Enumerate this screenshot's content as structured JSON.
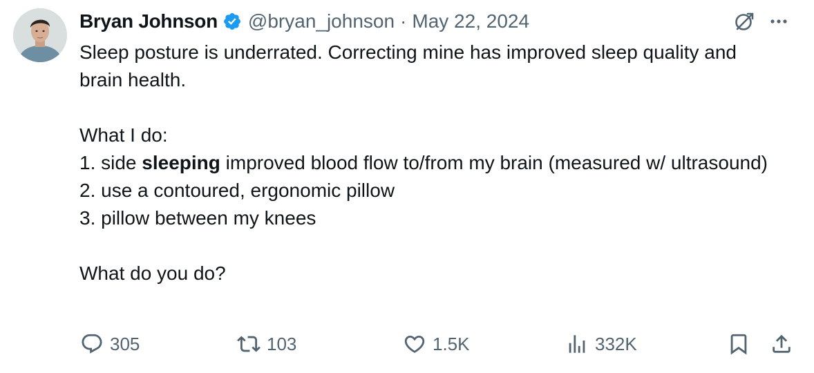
{
  "author": {
    "display_name": "Bryan Johnson",
    "handle": "@bryan_johnson",
    "separator": "·",
    "date": "May 22, 2024",
    "verified": true
  },
  "post": {
    "line1": "Sleep posture is underrated. Correcting mine has improved sleep quality and brain health.",
    "what_i_do": "What I do:",
    "item1_prefix": "1. side ",
    "item1_bold": "sleeping",
    "item1_suffix": " improved blood flow to/from my brain (measured w/ ultrasound)",
    "item2": "2. use a contoured, ergonomic pillow",
    "item3": "3. pillow between my knees",
    "question": "What do you do?"
  },
  "actions": {
    "replies": "305",
    "reposts": "103",
    "likes": "1.5K",
    "views": "332K"
  },
  "icons": {
    "reply": "reply-icon",
    "repost": "repost-icon",
    "like": "heart-icon",
    "views": "analytics-icon",
    "bookmark": "bookmark-icon",
    "share": "share-icon",
    "grok": "grok-icon",
    "more": "more-icon",
    "verified": "verified-badge-icon"
  },
  "colors": {
    "text": "#0f1419",
    "secondary": "#536471",
    "verified": "#1d9bf0"
  }
}
